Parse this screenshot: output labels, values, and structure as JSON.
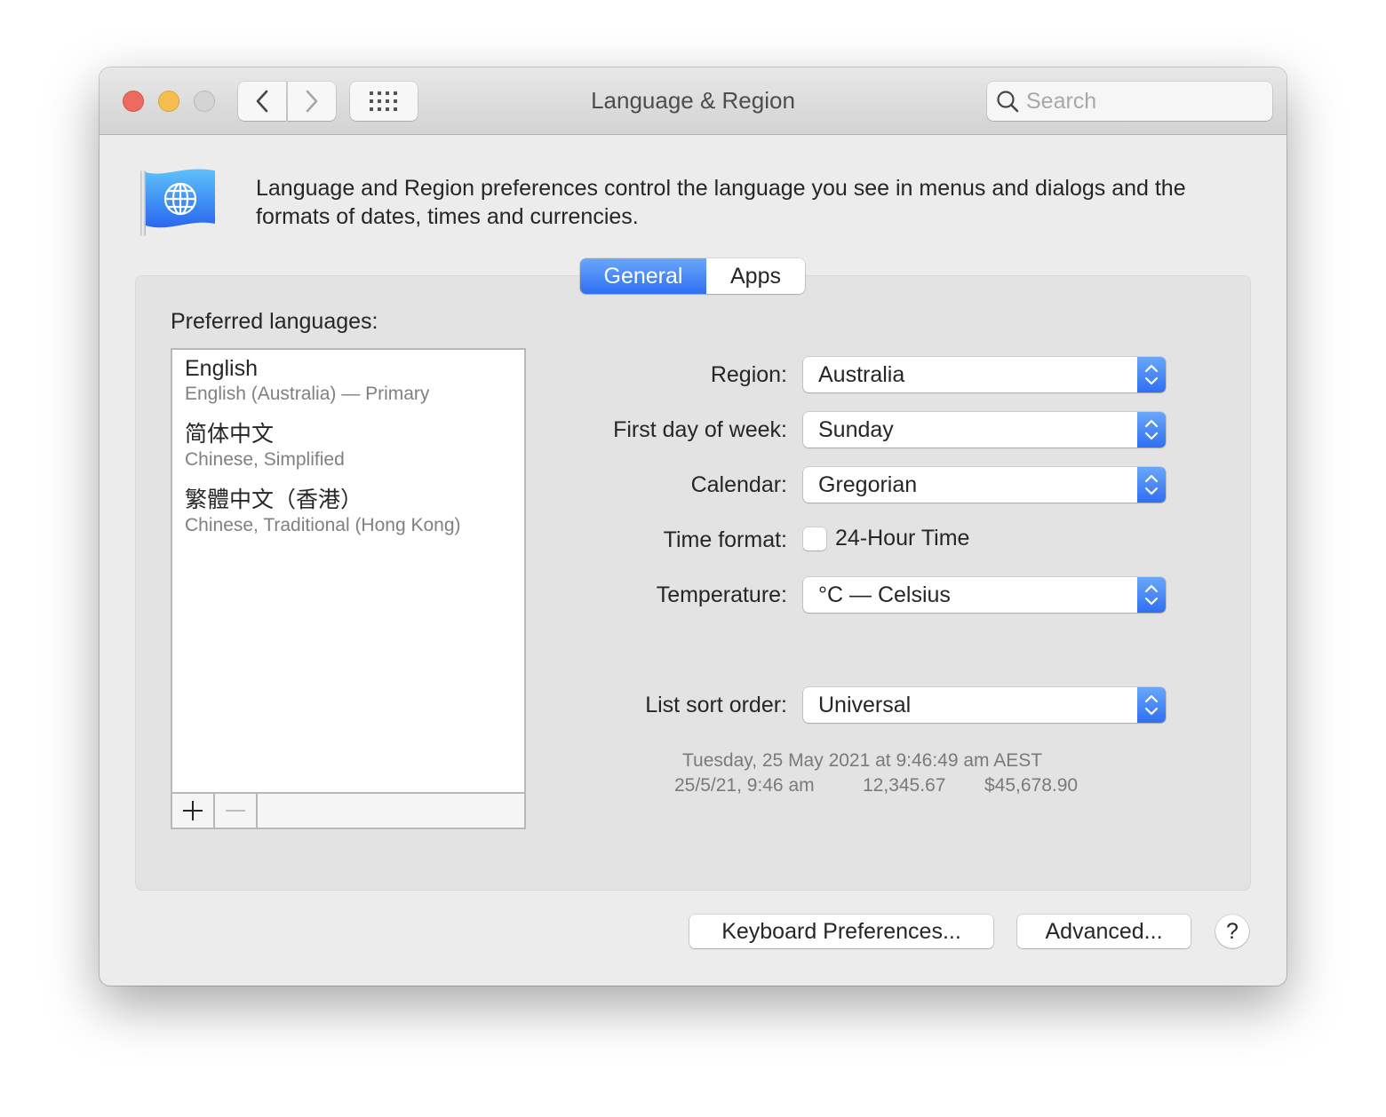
{
  "window": {
    "title": "Language & Region",
    "search_placeholder": "Search",
    "icons": {
      "close": "close-traffic-light",
      "minimize": "minimize-traffic-light",
      "zoom": "zoom-traffic-light",
      "back": "chevron-left-icon",
      "forward": "chevron-right-icon",
      "grid": "grid-icon",
      "search": "magnifier-icon",
      "pane": "globe-flag-icon"
    }
  },
  "description": "Language and Region preferences control the language you see in menus and dialogs and the formats of dates, times and currencies.",
  "tabs": [
    {
      "label": "General",
      "selected": true
    },
    {
      "label": "Apps",
      "selected": false
    }
  ],
  "preferred_languages": {
    "label": "Preferred languages:",
    "items": [
      {
        "name": "English",
        "detail": "English (Australia) — Primary"
      },
      {
        "name": "简体中文",
        "detail": "Chinese, Simplified"
      },
      {
        "name": "繁體中文（香港）",
        "detail": "Chinese, Traditional (Hong Kong)"
      }
    ],
    "add_label": "+",
    "remove_label": "—"
  },
  "settings": {
    "region": {
      "label": "Region:",
      "value": "Australia"
    },
    "first_day": {
      "label": "First day of week:",
      "value": "Sunday"
    },
    "calendar": {
      "label": "Calendar:",
      "value": "Gregorian"
    },
    "time_format": {
      "label": "Time format:",
      "checkbox_label": "24-Hour Time",
      "checked": false
    },
    "temperature": {
      "label": "Temperature:",
      "value": "°C — Celsius"
    },
    "list_sort": {
      "label": "List sort order:",
      "value": "Universal"
    }
  },
  "sample": {
    "long_date": "Tuesday, 25 May 2021 at 9:46:49 am AEST",
    "short_date": "25/5/21, 9:46 am",
    "number": "12,345.67",
    "currency": "$45,678.90"
  },
  "buttons": {
    "keyboard": "Keyboard Preferences...",
    "advanced": "Advanced...",
    "help": "?"
  },
  "colors": {
    "accent": "#2f6ff3",
    "close": "#ec6a5e",
    "minimize": "#f5bf4f",
    "zoom_disabled": "#d4d4d4"
  }
}
